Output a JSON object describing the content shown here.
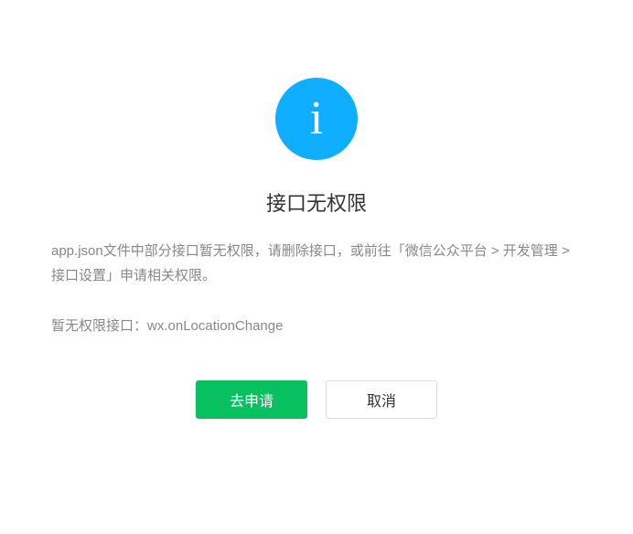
{
  "icon": {
    "name": "info",
    "color": "#10AEFF"
  },
  "title": "接口无权限",
  "description": "app.json文件中部分接口暂无权限，请删除接口，或前往「微信公众平台 > 开发管理 > 接口设置」申请相关权限。",
  "api_label": "暂无权限接口：",
  "api_name": "wx.onLocationChange",
  "buttons": {
    "apply_label": "去申请",
    "cancel_label": "取消"
  }
}
